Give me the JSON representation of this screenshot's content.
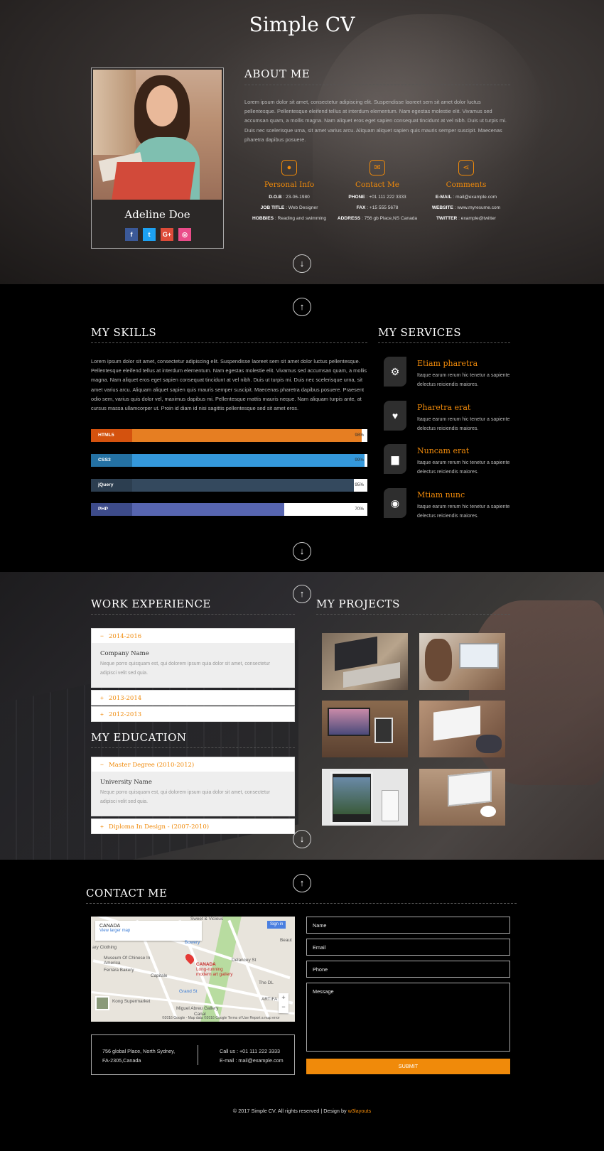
{
  "hero": {
    "site_title": "Simple CV",
    "profile_name": "Adeline Doe",
    "social": [
      {
        "icon": "facebook-icon",
        "glyph": "f",
        "color": "#3b5998"
      },
      {
        "icon": "twitter-icon",
        "glyph": "t",
        "color": "#1da1f2"
      },
      {
        "icon": "google-plus-icon",
        "glyph": "G+",
        "color": "#dd4b39"
      },
      {
        "icon": "dribbble-icon",
        "glyph": "◎",
        "color": "#ea4c89"
      }
    ],
    "about_title": "ABOUT ME",
    "about_text": "Lorem ipsum dolor sit amet, consectetur adipiscing elit. Suspendisse laoreet sem sit amet dolor luctus pellentesque. Pellentesque eleifend tellus at interdum elementum. Nam egestas molestie elit. Vivamus sed accumsan quam, a mollis magna. Nam aliquet eros eget sapien consequat tincidunt at vel nibh. Duis ut turpis mi. Duis nec scelerisque urna, sit amet varius arcu. Aliquam aliquet sapien quis mauris semper suscipit. Maecenas pharetra dapibus posuere.",
    "info": [
      {
        "icon": "user-icon",
        "title": "Personal Info",
        "lines": [
          {
            "k": "D.O.B",
            "v": "23-06-1980"
          },
          {
            "k": "JOB TITLE",
            "v": "Web Designer"
          },
          {
            "k": "HOBBIES",
            "v": "Reading and swimming"
          }
        ]
      },
      {
        "icon": "envelope-icon",
        "title": "Contact Me",
        "lines": [
          {
            "k": "PHONE",
            "v": "+01 111 222 3333"
          },
          {
            "k": "FAX",
            "v": "+15 555 5678"
          },
          {
            "k": "ADDRESS",
            "v": "756 gb Place,NS Canada"
          }
        ]
      },
      {
        "icon": "share-icon",
        "title": "Comments",
        "lines": [
          {
            "k": "E-MAIL",
            "v": "mail@example.com"
          },
          {
            "k": "WEBSITE",
            "v": "www.myresume.com"
          },
          {
            "k": "TWITTER",
            "v": "example@twitter"
          }
        ]
      }
    ]
  },
  "nav": {
    "down": "↓",
    "up": "↑"
  },
  "skills": {
    "title": "MY SKILLS",
    "text": "Lorem ipsum dolor sit amet, consectetur adipiscing elit. Suspendisse laoreet sem sit amet dolor luctus pellentesque. Pellentesque eleifend tellus at interdum elementum. Nam egestas molestie elit. Vivamus sed accumsan quam, a mollis magna. Nam aliquet eros eget sapien consequat tincidunt at vel nibh. Duis ut turpis mi. Duis nec scelerisque urna, sit amet varius arcu. Aliquam aliquet sapien quis mauris semper suscipit. Maecenas pharetra dapibus posuere. Praesent odio sem, varius quis dolor vel, maximus dapibus mi. Pellentesque mattis mauris neque. Nam aliquam turpis ante, at cursus massa ullamcorper ut. Proin id diam id nisi sagittis pellentesque sed sit amet eros.",
    "bars": [
      {
        "label": "HTML5",
        "percent": 98,
        "pct_text": "98%",
        "tag_color": "#d4520e",
        "fill_color": "#e67e22"
      },
      {
        "label": "CSS3",
        "percent": 99,
        "pct_text": "99%",
        "tag_color": "#2471a3",
        "fill_color": "#3498db"
      },
      {
        "label": "jQuery",
        "percent": 95,
        "pct_text": "95%",
        "tag_color": "#2c3e50",
        "fill_color": "#34495e"
      },
      {
        "label": "PHP",
        "percent": 70,
        "pct_text": "70%",
        "tag_color": "#3d4b8a",
        "fill_color": "#5765b0"
      }
    ]
  },
  "services": {
    "title": "MY SERVICES",
    "items": [
      {
        "icon": "gear-icon",
        "glyph": "⚙",
        "title": "Etiam pharetra",
        "desc": "Itaque earum rerum hic tenetur a sapiente delectus reiciendis maiores."
      },
      {
        "icon": "heart-icon",
        "glyph": "♥",
        "title": "Pharetra erat",
        "desc": "Itaque earum rerum hic tenetur a sapiente delectus reiciendis maiores."
      },
      {
        "icon": "bar-chart-icon",
        "glyph": "▆",
        "title": "Nuncаm erat",
        "desc": "Itaque earum rerum hic tenetur a sapiente delectus reiciendis maiores."
      },
      {
        "icon": "camera-icon",
        "glyph": "◉",
        "title": "Mtiam nunc",
        "desc": "Itaque earum rerum hic tenetur a sapiente delectus reiciendis maiores."
      }
    ]
  },
  "work": {
    "title": "WORK EXPERIENCE",
    "open": {
      "head": "2014-2016",
      "title": "Company Name",
      "desc": "Neque porro quisquam est, qui dolorem ipsum quia dolor sit amet, consectetur adipisci velit sed quia."
    },
    "closed": [
      "2013-2014",
      "2012-2013"
    ]
  },
  "education": {
    "title": "MY EDUCATION",
    "open": {
      "head": "Master Degree (2010-2012)",
      "title": "University Name",
      "desc": "Neque porro quisquam est, qui dolorem ipsum quia dolor sit amet, consectetur adipisci velit sed quia."
    },
    "closed": [
      "Diploma In Design - (2007-2010)"
    ]
  },
  "projects": {
    "title": "MY PROJECTS"
  },
  "contact": {
    "title": "CONTACT ME",
    "map": {
      "place": "CANADA",
      "larger_link": "View larger map",
      "sign_in": "Sign in",
      "pin_label": "CANADA",
      "pin_sub": "Long-running modern art gallery",
      "labels": [
        "Sweet & Vicious",
        "Bowery",
        "ary Clothing",
        "Museum Of Chinese In America",
        "Ferrara Bakery",
        "Capitale",
        "Delancey St",
        "Grand St",
        "The DL",
        "ARTIFA",
        "Kong Supermarket",
        "Miguel Abreu Gallery",
        "Beaut",
        "Canal"
      ],
      "footer": "©2016 Google - Map data ©2016 Google   Terms of Use   Report a map error"
    },
    "address_lines": [
      "756 global Place, North Sydney,",
      "FA-2305,Canada"
    ],
    "call_lines": [
      "Call us : +01 111 222 3333",
      "E-mail : mail@example.com"
    ],
    "form": {
      "name": "Name",
      "email": "Email",
      "phone": "Phone",
      "message": "Message",
      "submit": "SUBMIT"
    }
  },
  "footer": {
    "text": "© 2017 Simple CV. All rights reserved | Design by ",
    "brand": "w3layouts"
  },
  "colors": {
    "accent": "#f08a0a"
  }
}
